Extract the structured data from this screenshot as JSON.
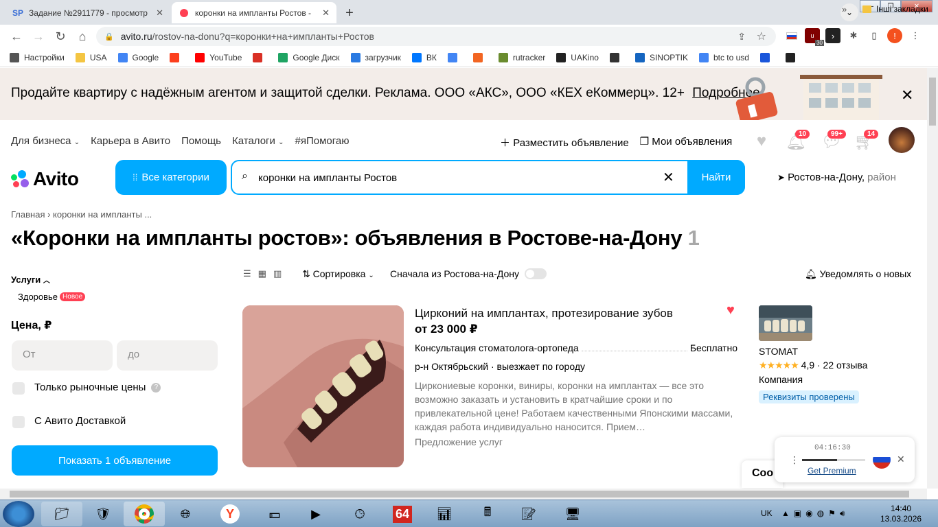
{
  "browser": {
    "tabs": [
      {
        "title": "Задание №2911779 - просмотр",
        "favicon": "SP",
        "active": false
      },
      {
        "title": "коронки на импланты Ростов -",
        "favicon": "avito",
        "active": true
      }
    ],
    "url_host": "avito.ru",
    "url_path": "/rostov-na-donu?q=коронки+на+импланты+Ростов",
    "extension_badge": "30",
    "bookmarks": [
      {
        "label": "Настройки",
        "icon": "gear-icon",
        "color": "#555555"
      },
      {
        "label": "USA",
        "icon": "folder-icon",
        "color": "#f4c542"
      },
      {
        "label": "Google",
        "icon": "google-icon",
        "color": "#4285f4"
      },
      {
        "label": "",
        "icon": "yandex-icon",
        "color": "#fc3f1d"
      },
      {
        "label": "YouTube",
        "icon": "youtube-icon",
        "color": "#ff0000"
      },
      {
        "label": "",
        "icon": "gmail-icon",
        "color": "#d93025"
      },
      {
        "label": "Google Диск",
        "icon": "drive-icon",
        "color": "#1fa463"
      },
      {
        "label": "загрузчик",
        "icon": "loader-icon",
        "color": "#2a7ae2"
      },
      {
        "label": "ВК",
        "icon": "vk-icon",
        "color": "#0077ff"
      },
      {
        "label": "",
        "icon": "translate-icon",
        "color": "#4285f4"
      },
      {
        "label": "",
        "icon": "f-icon",
        "color": "#f26522"
      },
      {
        "label": "rutracker",
        "icon": "rutracker-icon",
        "color": "#6a8c2f"
      },
      {
        "label": "UAKino",
        "icon": "uakino-icon",
        "color": "#222222"
      },
      {
        "label": "",
        "icon": "figure-icon",
        "color": "#333333"
      },
      {
        "label": "SINOPTIK",
        "icon": "thermometer-icon",
        "color": "#1565c0"
      },
      {
        "label": "btc to usd",
        "icon": "google-icon",
        "color": "#4285f4"
      },
      {
        "label": "",
        "icon": "arrow-icon",
        "color": "#1a56db"
      },
      {
        "label": "",
        "icon": "bc-icon",
        "color": "#222222"
      }
    ],
    "bookmarks_more": "»",
    "other_bookmarks": "Інші закладки"
  },
  "ad_banner": {
    "text": "Продайте квартиру с надёжным агентом и защитой сделки. Реклама. ООО «АКС», ООО «КЕХ еКоммерц». 12+",
    "link": "Подробнее"
  },
  "topnav": {
    "links": [
      "Для бизнеса",
      "Карьера в Авито",
      "Помощь",
      "Каталоги",
      "#яПомогаю"
    ],
    "post_ad": "Разместить объявление",
    "my_ads": "Мои объявления",
    "notifications_count": "10",
    "messages_count": "99+",
    "cart_count": "14"
  },
  "logo": "Avito",
  "categories_button": "Все категории",
  "search": {
    "value": "коронки на импланты Ростов",
    "button": "Найти"
  },
  "location": {
    "city": "Ростов-на-Дону,",
    "sub": " район"
  },
  "breadcrumb": "Главная › коронки на импланты ...",
  "title": {
    "text": "«Коронки на импланты ростов»: объявления в Ростове-на-Дону",
    "count": "1"
  },
  "filters": {
    "services_label": "Услуги",
    "health_label": "Здоровье",
    "new_badge": "Новое",
    "price_label": "Цена, ₽",
    "price_from_placeholder": "От",
    "price_to_placeholder": "до",
    "market_prices": "Только рыночные цены",
    "avito_delivery": "С Авито Доставкой",
    "show_button": "Показать 1 объявление"
  },
  "results_bar": {
    "sort": "Сортировка",
    "rostov_first": "Сначала из Ростова-на-Дону",
    "notify": "Уведомлять о новых"
  },
  "listing": {
    "title": "Цирконий на имплантах, протезирование зубов",
    "price": "от 23 000 ₽",
    "service_name": "Консультация стоматолога-ортопеда",
    "service_price": "Бесплатно",
    "district": "р-н Октябрьский · выезжает по городу",
    "description": "Циркониевые коронки, виниры, коронки на имплантах — все это возможно заказать и установить в кратчайшие сроки и по привлекательной цене! Работаем качественными Японскими массами, каждая работа индивидуально наносится. Прием…",
    "type": "Предложение услуг",
    "seller": {
      "name": "STOMAT",
      "stars": "★★★★★",
      "rating": "4,9 · 22 отзыва",
      "kind": "Компания",
      "verified": "Реквизиты проверены"
    }
  },
  "promo_partial": "Coo",
  "vpn": {
    "timer": "04:16:30",
    "premium": "Get Premium",
    "progress": 0.55
  },
  "taskbar": {
    "lang": "UK",
    "time": "14:40",
    "date": "13.03.2026"
  }
}
